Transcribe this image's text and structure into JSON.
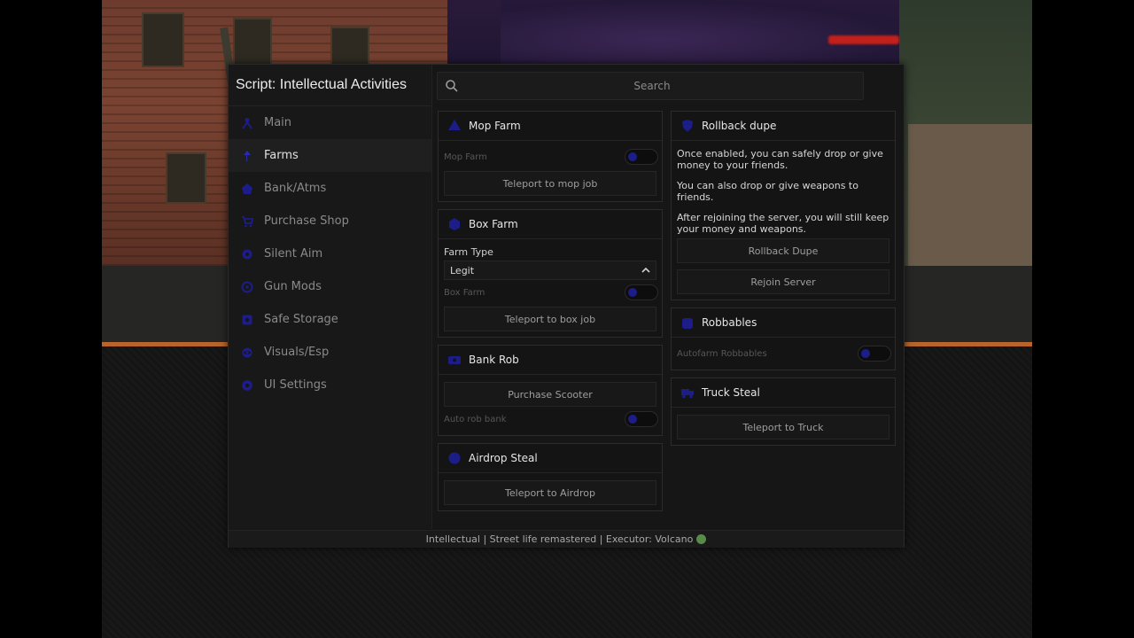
{
  "window": {
    "title": "Script: Intellectual Activities",
    "search_placeholder": "Search",
    "footer": "Intellectual | Street life remastered | Executor: Volcano"
  },
  "colors": {
    "accent": "#1d1d8a",
    "status_dot": "#5a8a4a"
  },
  "sidebar": {
    "items": [
      {
        "label": "Main",
        "icon": "person-icon"
      },
      {
        "label": "Farms",
        "icon": "pin-icon",
        "active": true
      },
      {
        "label": "Bank/Atms",
        "icon": "bank-icon"
      },
      {
        "label": "Purchase Shop",
        "icon": "cart-icon"
      },
      {
        "label": "Silent Aim",
        "icon": "crosshair-icon"
      },
      {
        "label": "Gun Mods",
        "icon": "target-icon"
      },
      {
        "label": "Safe Storage",
        "icon": "vault-icon"
      },
      {
        "label": "Visuals/Esp",
        "icon": "eye-icon"
      },
      {
        "label": "UI Settings",
        "icon": "gear-icon"
      }
    ]
  },
  "left": {
    "mop": {
      "title": "Mop Farm",
      "toggle_label": "Mop Farm",
      "button": "Teleport to mop job"
    },
    "box": {
      "title": "Box Farm",
      "type_label": "Farm Type",
      "type_value": "Legit",
      "toggle_label": "Box Farm",
      "button": "Teleport to box job"
    },
    "bank": {
      "title": "Bank Rob",
      "button": "Purchase Scooter",
      "toggle_label": "Auto rob bank"
    },
    "airdrop": {
      "title": "Airdrop Steal",
      "button": "Teleport to Airdrop"
    }
  },
  "right": {
    "rollback": {
      "title": "Rollback dupe",
      "p1": "Once enabled, you can safely drop or give money to your friends.",
      "p2": "You can also drop or give weapons to friends.",
      "p3": "After rejoining the server, you will still keep your money and weapons.",
      "button1": "Rollback Dupe",
      "button2": "Rejoin Server"
    },
    "robbables": {
      "title": "Robbables",
      "toggle_label": "Autofarm Robbables"
    },
    "truck": {
      "title": "Truck Steal",
      "button": "Teleport to Truck"
    }
  }
}
